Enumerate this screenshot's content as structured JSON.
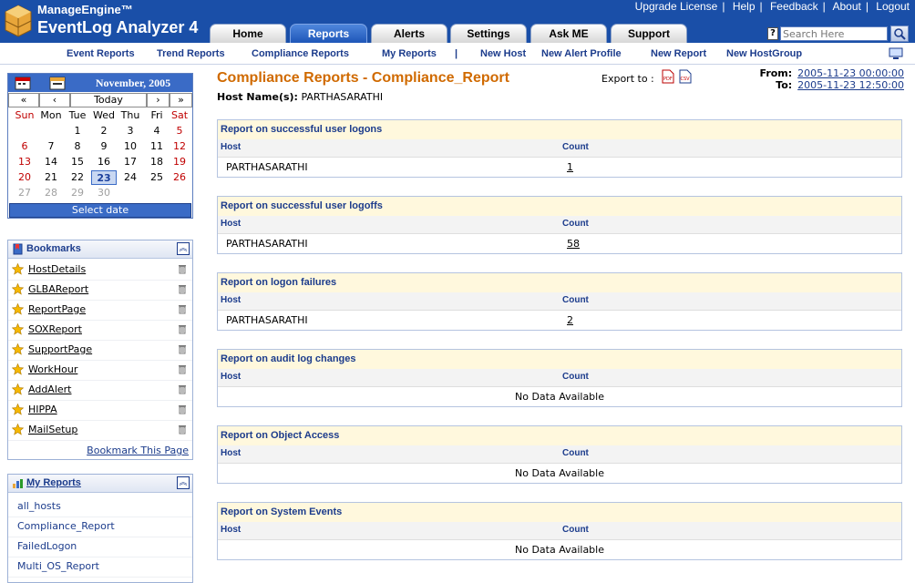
{
  "header": {
    "brand_top": "ManageEngine™",
    "brand_main": "EventLog Analyzer 4",
    "top_links": [
      "Upgrade License",
      "Help",
      "Feedback",
      "About",
      "Logout"
    ],
    "tabs": [
      {
        "label": "Home",
        "active": false
      },
      {
        "label": "Reports",
        "active": true
      },
      {
        "label": "Alerts",
        "active": false
      },
      {
        "label": "Settings",
        "active": false
      },
      {
        "label": "Ask ME",
        "active": false
      },
      {
        "label": "Support",
        "active": false
      }
    ],
    "search_placeholder": "Search Here"
  },
  "subnav": {
    "items": [
      "Event Reports",
      "Trend Reports",
      "Compliance Reports",
      "My Reports"
    ],
    "separator": "|",
    "actions": [
      "New Host",
      "New Alert Profile",
      "New Report",
      "New HostGroup"
    ]
  },
  "calendar": {
    "title": "November, 2005",
    "nav": [
      "«",
      "‹",
      "Today",
      "›",
      "»"
    ],
    "dow": [
      "Sun",
      "Mon",
      "Tue",
      "Wed",
      "Thu",
      "Fri",
      "Sat"
    ],
    "weeks": [
      [
        "",
        "",
        "1",
        "2",
        "3",
        "4",
        "5"
      ],
      [
        "6",
        "7",
        "8",
        "9",
        "10",
        "11",
        "12"
      ],
      [
        "13",
        "14",
        "15",
        "16",
        "17",
        "18",
        "19"
      ],
      [
        "20",
        "21",
        "22",
        "23",
        "24",
        "25",
        "26"
      ],
      [
        "27",
        "28",
        "29",
        "30",
        "",
        "",
        ""
      ]
    ],
    "today": "23",
    "select_label": "Select date"
  },
  "bookmarks": {
    "title": "Bookmarks",
    "items": [
      "HostDetails",
      "GLBAReport",
      "ReportPage",
      "SOXReport",
      "SupportPage",
      "WorkHour",
      "AddAlert",
      "HIPPA",
      "MailSetup"
    ],
    "bookmark_this": "Bookmark This Page"
  },
  "my_reports": {
    "title": "My Reports",
    "items": [
      "all_hosts",
      "Compliance_Report",
      "FailedLogon",
      "Multi_OS_Report"
    ]
  },
  "main": {
    "title": "Compliance Reports - Compliance_Report",
    "export_label": "Export to :",
    "from_label": "From:",
    "from_value": "2005-11-23 00:00:00",
    "to_label": "To:",
    "to_value": "2005-11-23 12:50:00",
    "host_label": "Host Name(s):",
    "host_value": "PARTHASARATHI",
    "col_host": "Host",
    "col_count": "Count",
    "no_data": "No Data Available",
    "reports": [
      {
        "title": "Report on successful user logons",
        "host": "PARTHASARATHI",
        "count": "1"
      },
      {
        "title": "Report on successful user logoffs",
        "host": "PARTHASARATHI",
        "count": "58"
      },
      {
        "title": "Report on logon failures",
        "host": "PARTHASARATHI",
        "count": "2"
      },
      {
        "title": "Report on audit log changes",
        "host": "",
        "count": ""
      },
      {
        "title": "Report on Object Access",
        "host": "",
        "count": ""
      },
      {
        "title": "Report on System Events",
        "host": "",
        "count": ""
      }
    ]
  }
}
